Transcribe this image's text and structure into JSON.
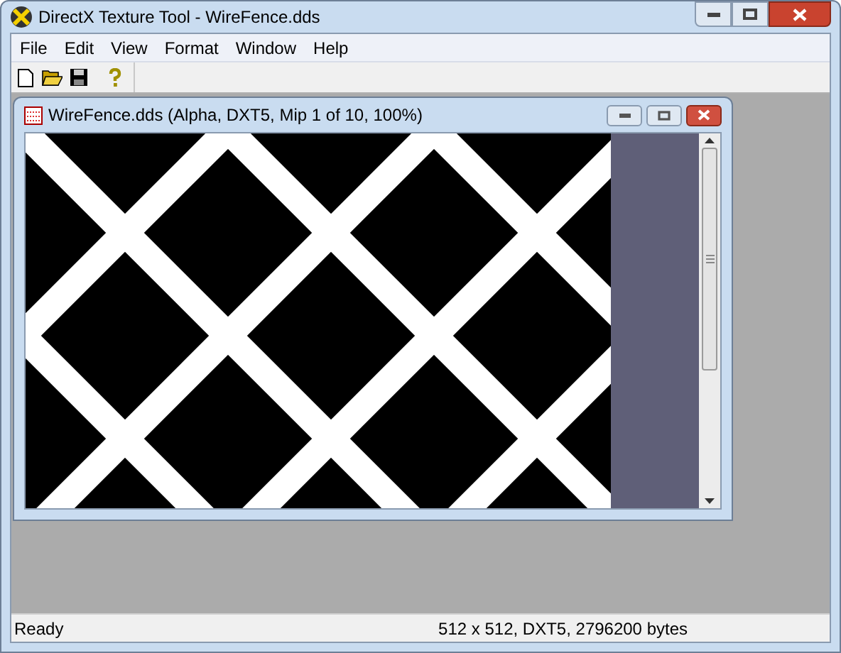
{
  "window": {
    "title": "DirectX Texture Tool - WireFence.dds"
  },
  "menu": [
    "File",
    "Edit",
    "View",
    "Format",
    "Window",
    "Help"
  ],
  "child_window": {
    "title": "WireFence.dds (Alpha, DXT5, Mip 1 of 10, 100%)"
  },
  "status_bar": [
    "Ready",
    "512 x 512, DXT5, 2796200 bytes"
  ]
}
